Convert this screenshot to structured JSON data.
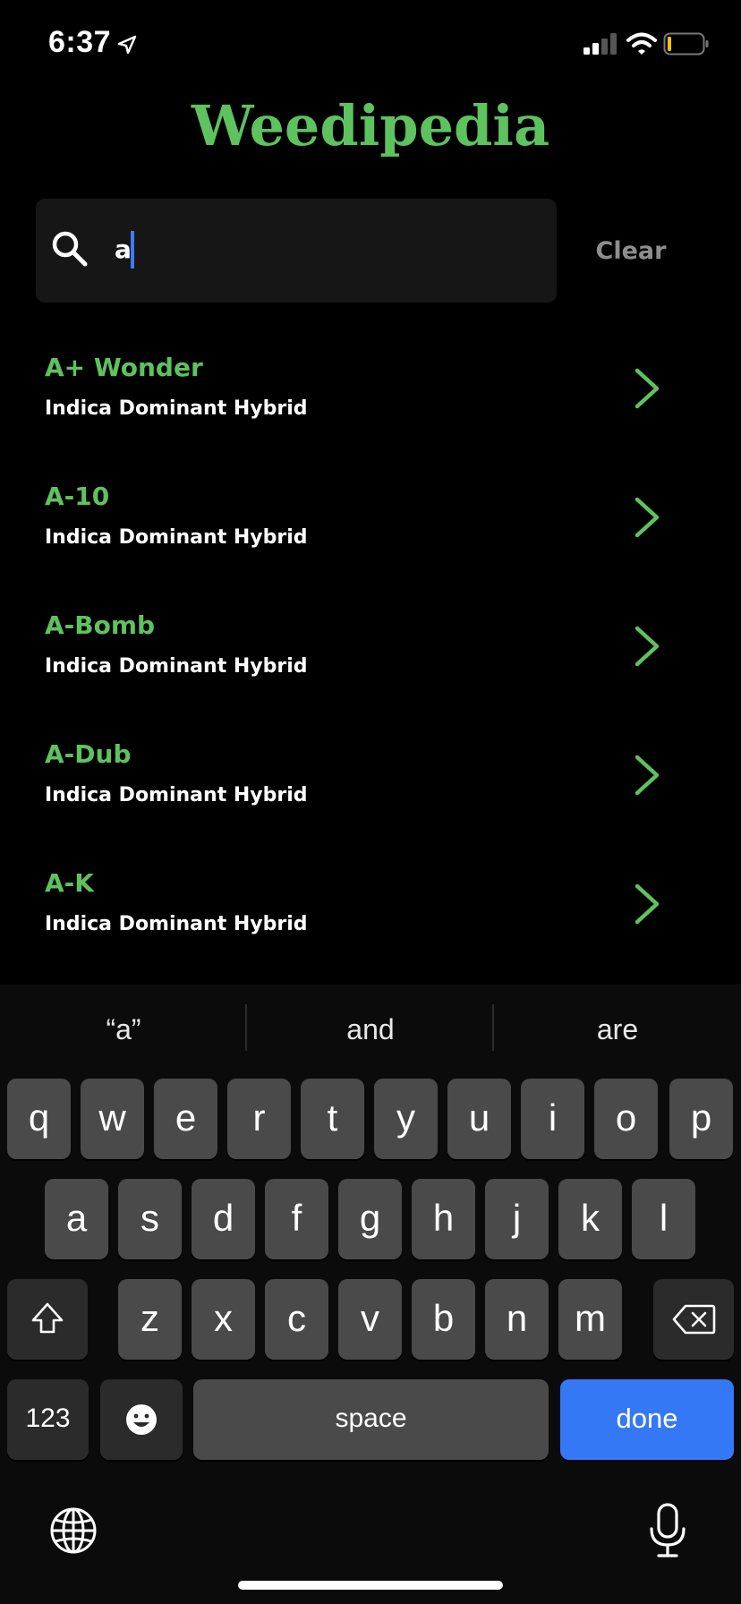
{
  "status_bar": {
    "time": "6:37"
  },
  "app": {
    "title": "Weedipedia"
  },
  "search": {
    "value": "a",
    "clear_label": "Clear"
  },
  "strains": [
    {
      "name": "A+ Wonder",
      "type": "Indica Dominant Hybrid"
    },
    {
      "name": "A-10",
      "type": "Indica Dominant Hybrid"
    },
    {
      "name": "A-Bomb",
      "type": "Indica Dominant Hybrid"
    },
    {
      "name": "A-Dub",
      "type": "Indica Dominant Hybrid"
    },
    {
      "name": "A-K",
      "type": "Indica Dominant Hybrid"
    }
  ],
  "keyboard": {
    "suggestions": [
      "“a”",
      "and",
      "are"
    ],
    "row1": [
      "q",
      "w",
      "e",
      "r",
      "t",
      "y",
      "u",
      "i",
      "o",
      "p"
    ],
    "row2": [
      "a",
      "s",
      "d",
      "f",
      "g",
      "h",
      "j",
      "k",
      "l"
    ],
    "row3": [
      "z",
      "x",
      "c",
      "v",
      "b",
      "n",
      "m"
    ],
    "numbers_label": "123",
    "space_label": "space",
    "done_label": "done"
  },
  "colors": {
    "accent": "#5ec25f",
    "done_key": "#3478f6",
    "background": "#000000"
  },
  "icons": [
    "location-arrow-icon",
    "signal-icon",
    "wifi-icon",
    "battery-icon",
    "search-icon",
    "chevron-right-icon",
    "shift-icon",
    "delete-icon",
    "emoji-icon",
    "globe-icon",
    "microphone-icon"
  ]
}
